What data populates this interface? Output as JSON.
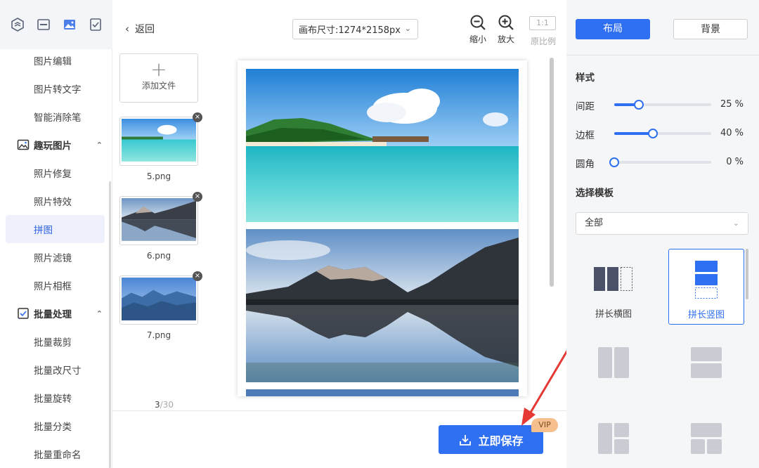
{
  "sidebar": {
    "top_icons": [
      "layers-icon",
      "image-edit-icon",
      "picture-icon",
      "checklist-icon"
    ],
    "items": [
      {
        "label": "图片编辑"
      },
      {
        "label": "图片转文字"
      },
      {
        "label": "智能消除笔"
      },
      {
        "label": "照片修复"
      },
      {
        "label": "照片特效"
      },
      {
        "label": "拼图",
        "active": true
      },
      {
        "label": "照片滤镜"
      },
      {
        "label": "照片相框"
      },
      {
        "label": "批量裁剪"
      },
      {
        "label": "批量改尺寸"
      },
      {
        "label": "批量旋转"
      },
      {
        "label": "批量分类"
      },
      {
        "label": "批量重命名"
      }
    ],
    "groups": [
      {
        "label": "趣玩图片",
        "icon": "fun-image-icon",
        "expanded": true
      },
      {
        "label": "批量处理",
        "icon": "batch-icon",
        "expanded": true
      }
    ]
  },
  "toolbar": {
    "back_label": "返回",
    "canvas_size": "画布尺寸:1274*2158px",
    "zoom_out": "缩小",
    "zoom_in": "放大",
    "ratio_box": "1:1",
    "ratio_label": "原比例"
  },
  "files": {
    "add_label": "添加文件",
    "items": [
      {
        "name": "5.png"
      },
      {
        "name": "6.png"
      },
      {
        "name": "7.png"
      }
    ],
    "count_current": "3",
    "count_total": "/30"
  },
  "save": {
    "label": "立即保存",
    "badge": "VIP"
  },
  "panel": {
    "tab_layout": "布局",
    "tab_background": "背景",
    "style_title": "样式",
    "sliders": [
      {
        "label": "间距",
        "value": 25,
        "display": "25  %"
      },
      {
        "label": "边框",
        "value": 40,
        "display": "40  %"
      },
      {
        "label": "圆角",
        "value": 0,
        "display": "0  %"
      }
    ],
    "template_title": "选择模板",
    "template_select": "全部",
    "templates": [
      {
        "label": "拼长横图",
        "selected": false
      },
      {
        "label": "拼长竖图",
        "selected": true
      }
    ]
  },
  "colors": {
    "accent": "#2f6ff2",
    "annotation_arrow": "#e53935",
    "vip_badge": "#f6c08e"
  }
}
